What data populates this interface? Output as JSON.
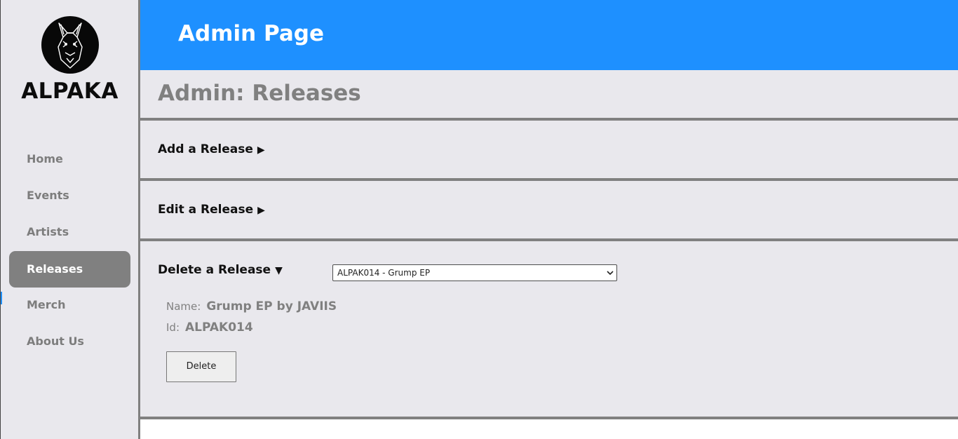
{
  "sidebar": {
    "brand": "ALPAKA",
    "logo_icon": "alpaca-logo-icon",
    "items": [
      {
        "label": "Home"
      },
      {
        "label": "Events"
      },
      {
        "label": "Artists"
      },
      {
        "label": "Releases",
        "active": true
      },
      {
        "label": "Merch"
      },
      {
        "label": "About Us"
      }
    ]
  },
  "header": {
    "title": "Admin Page"
  },
  "main": {
    "title": "Admin: Releases",
    "sections": [
      {
        "label": "Add a Release",
        "arrow": "▶",
        "expanded": false
      },
      {
        "label": "Edit a Release",
        "arrow": "▶",
        "expanded": false
      },
      {
        "label": "Delete a Release",
        "arrow": "▼",
        "expanded": true
      }
    ],
    "delete": {
      "selected_option": "ALPAK014 - Grump EP",
      "name_label": "Name:",
      "name_value": "Grump EP by JAVIIS",
      "id_label": "Id:",
      "id_value": "ALPAK014",
      "button_label": "Delete"
    }
  },
  "colors": {
    "header_blue": "#1e90ff",
    "panel_bg": "#e9e8ed",
    "active_nav": "#808080",
    "text_gray": "#808080"
  }
}
